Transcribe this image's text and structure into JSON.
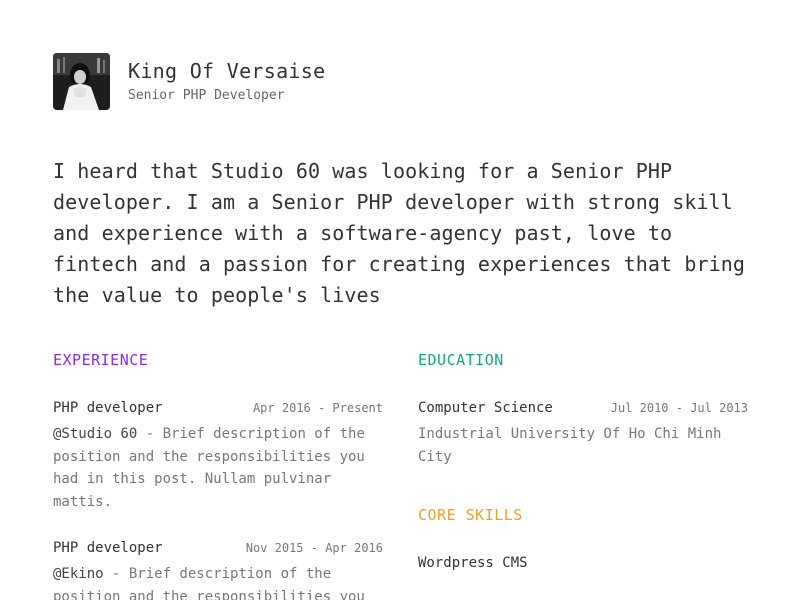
{
  "profile": {
    "name": "King Of Versaise",
    "title": "Senior PHP Developer",
    "avatar_alt": "profile photo"
  },
  "intro": "I heard that Studio 60 was looking for a Senior PHP developer. I am a Senior PHP developer with strong skill and experience with a software-agency past, love to fintech and a passion for creating experiences that bring the value to people's lives",
  "experience": {
    "heading": "EXPERIENCE",
    "color": "#8a2be2",
    "items": [
      {
        "role": "PHP developer",
        "date": "Apr 2016 - Present",
        "company": "@Studio 60",
        "description": " - Brief description of the position and the responsibilities you had in this post. Nullam pulvinar mattis."
      },
      {
        "role": "PHP developer",
        "date": "Nov 2015 - Apr 2016",
        "company": "@Ekino",
        "description": " - Brief description of the position and the responsibilities you"
      }
    ]
  },
  "education": {
    "heading": "EDUCATION",
    "color": "#1aa38a",
    "items": [
      {
        "degree": "Computer Science",
        "date": "Jul 2010 - Jul 2013",
        "school": "Industrial University Of Ho Chi Minh City"
      }
    ]
  },
  "skills": {
    "heading": "CORE SKILLS",
    "color": "#f0a020",
    "items": [
      "Wordpress CMS"
    ]
  }
}
